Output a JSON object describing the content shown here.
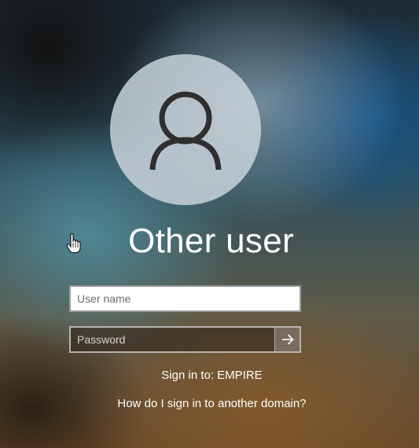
{
  "user": {
    "display_name": "Other user",
    "avatar_icon": "user-silhouette-icon"
  },
  "form": {
    "username_placeholder": "User name",
    "username_value": "",
    "password_placeholder": "Password",
    "password_value": "",
    "submit_icon": "arrow-right-icon"
  },
  "sign_in_to": "Sign in to: EMPIRE",
  "other_domain_link": "How do I sign in to another domain?",
  "colors": {
    "text": "#ffffff",
    "username_field_bg": "#ffffff",
    "password_field_bg": "#3a2d20"
  }
}
